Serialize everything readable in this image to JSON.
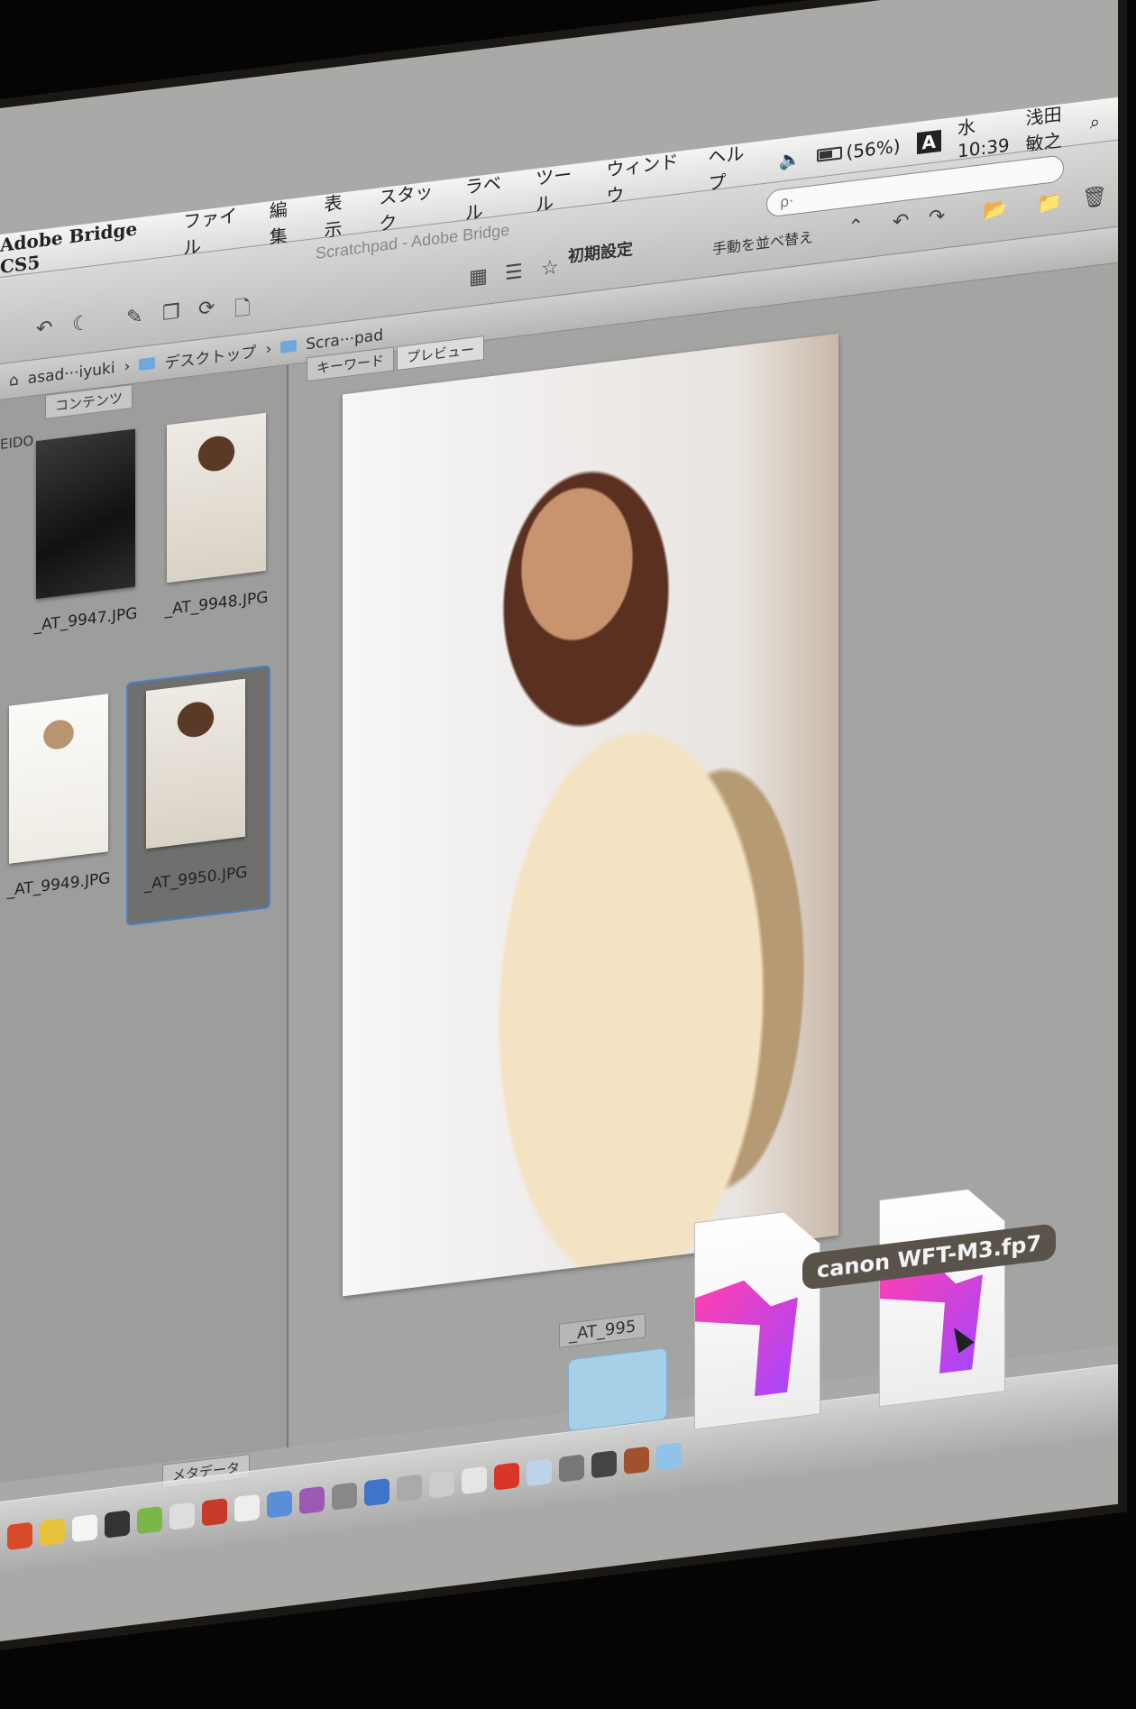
{
  "menubar": {
    "app_name": "Adobe Bridge CS5",
    "items": [
      "ファイル",
      "編集",
      "表示",
      "スタック",
      "ラベル",
      "ツール",
      "ウィンドウ",
      "ヘルプ"
    ],
    "battery": "(56%)",
    "ime": "A",
    "clock": "水 10:39",
    "user": "浅田敏之"
  },
  "window": {
    "title": "Scratchpad - Adobe Bridge",
    "workspace": "初期設定",
    "search_placeholder": "ρ·",
    "sort_label": "手動を並べ替え"
  },
  "path": [
    "asad···iyuki",
    "デスクトップ",
    "Scra···pad"
  ],
  "panels": {
    "content_tab": "コンテンツ",
    "keyword_tab": "キーワード",
    "preview_tab": "プレビュー",
    "metadata_tab": "メタデータ",
    "side_stub": "EIDO"
  },
  "thumbnails": [
    {
      "label": "_AT_9947.JPG",
      "style": "dark"
    },
    {
      "label": "_AT_9948.JPG",
      "style": "portrait"
    },
    {
      "label": "_AT_9949.JPG",
      "style": "light"
    },
    {
      "label": "_AT_9950.JPG",
      "style": "portrait",
      "selected": true
    }
  ],
  "preview": {
    "caption": "_AT_995"
  },
  "drag": {
    "tooltip": "canon WFT-M3.fp7"
  },
  "colors": {
    "selection": "#4a7fd0",
    "accent_pink": "#ff3fb0",
    "accent_purple": "#a346ff",
    "folder_blue": "#6fa8dc"
  },
  "icons": [
    "search-icon",
    "volume-icon",
    "battery-icon",
    "star-icon",
    "undo-icon",
    "redo-icon",
    "folder-icon",
    "cursor-icon"
  ]
}
